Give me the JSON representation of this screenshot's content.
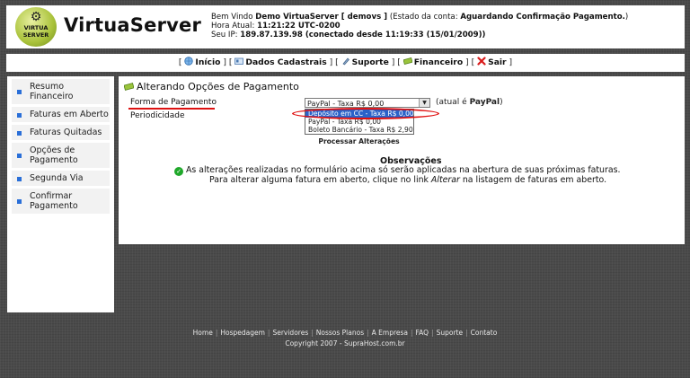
{
  "header": {
    "logo_top": "VIRTUA",
    "logo_bottom": "SERVER",
    "title": "VirtuaServer",
    "welcome_prefix": "Bem Vindo",
    "user": "Demo VirtuaServer [ demovs ]",
    "status_prefix": "(Estado da conta:",
    "status": "Aguardando Confirmação Pagamento.",
    "status_suffix": ")",
    "time_label": "Hora Atual:",
    "time_value": "11:21:22 UTC-0200",
    "ip_label": "Seu IP:",
    "ip_value": "189.87.139.98 (conectado desde 11:19:33 (15/01/2009))"
  },
  "nav": {
    "items": [
      {
        "label": "Início",
        "icon": "globe-icon"
      },
      {
        "label": "Dados Cadastrais",
        "icon": "card-icon"
      },
      {
        "label": "Suporte",
        "icon": "support-icon"
      },
      {
        "label": "Financeiro",
        "icon": "money-icon"
      },
      {
        "label": "Sair",
        "icon": "close-icon"
      }
    ]
  },
  "sidebar": {
    "items": [
      {
        "label": "Resumo Financeiro"
      },
      {
        "label": "Faturas em Aberto"
      },
      {
        "label": "Faturas Quitadas"
      },
      {
        "label": "Opções de Pagamento"
      },
      {
        "label": "Segunda Via"
      },
      {
        "label": "Confirmar Pagamento"
      }
    ]
  },
  "main": {
    "title": "Alterando Opções de Pagamento",
    "payment_label": "Forma de Pagamento",
    "period_label": "Periodicidade",
    "select_value": "PayPal - Taxa R$ 0,00",
    "atual_prefix": "(atual é",
    "atual_value": "PayPal",
    "atual_suffix": ")",
    "options": [
      "Depósito em CC - Taxa R$ 0,00",
      "PayPal - Taxa R$ 0,00",
      "Boleto Bancário - Taxa R$ 2,90"
    ],
    "process_button": "Processar Alterações",
    "obs_title": "Observações",
    "obs_line1": "As alterações realizadas no formulário acima só serão aplicadas na abertura de suas próximas faturas.",
    "obs_line2_a": "Para alterar alguma fatura em aberto, clique no link",
    "obs_line2_link": "Alterar",
    "obs_line2_b": "na listagem de faturas em aberto."
  },
  "footer": {
    "links": [
      "Home",
      "Hospedagem",
      "Servidores",
      "Nossos Planos",
      "A Empresa",
      "FAQ",
      "Suporte",
      "Contato"
    ],
    "copyright": "Copyright 2007 - SupraHost.com.br"
  }
}
